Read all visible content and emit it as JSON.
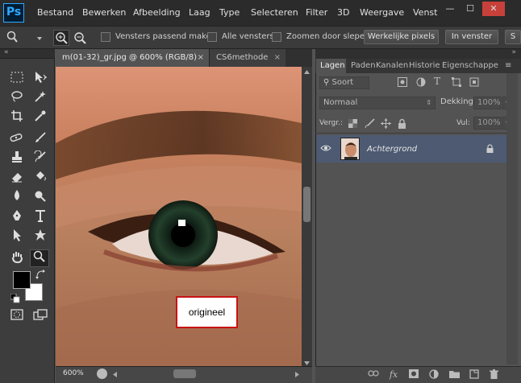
{
  "app": {
    "logo": "Ps"
  },
  "menu": [
    "Bestand",
    "Bewerken",
    "Afbeelding",
    "Laag",
    "Type",
    "Selecteren",
    "Filter",
    "3D",
    "Weergave",
    "Venst"
  ],
  "window_controls": {
    "minimize": "—",
    "maximize": "☐",
    "close": "✕"
  },
  "options": {
    "zoom_icon": "zoom-icon",
    "checks": [
      {
        "label": "Vensters passend maken",
        "checked": false
      },
      {
        "label": "Alle vensters",
        "checked": false
      },
      {
        "label": "Zoomen door slepen",
        "checked": false
      }
    ],
    "actual_pixels": "Werkelijke pixels",
    "fit_screen": "In venster",
    "fill_screen": "S"
  },
  "document": {
    "tabs": [
      {
        "title": "m(01-32)_gr.jpg @ 600% (RGB/8)",
        "close": "×",
        "active": true
      },
      {
        "title": "CS6methode",
        "close": "×",
        "active": false
      }
    ],
    "zoom": "600%",
    "callout": "origineel"
  },
  "panel": {
    "tabs": [
      "Lagen",
      "Paden",
      "Kanalen",
      "Historie",
      "Eigenschappe"
    ],
    "filter_label": "Soort",
    "blend_mode": "Normaal",
    "opacity_label": "Dekking:",
    "opacity_value": "100%",
    "lock_label": "Vergr.:",
    "fill_label": "Vul:",
    "fill_value": "100%",
    "layers": [
      {
        "name": "Achtergrond",
        "visible": true,
        "locked": true
      }
    ],
    "bottom_icons": [
      "link-icon",
      "fx-icon",
      "mask-icon",
      "adjustment-icon",
      "group-icon",
      "new-layer-icon",
      "trash-icon"
    ]
  },
  "colors": {
    "foreground": "#000000",
    "background": "#ffffff",
    "accent": "#31a8ff",
    "selected_layer": "#4d5a72"
  }
}
